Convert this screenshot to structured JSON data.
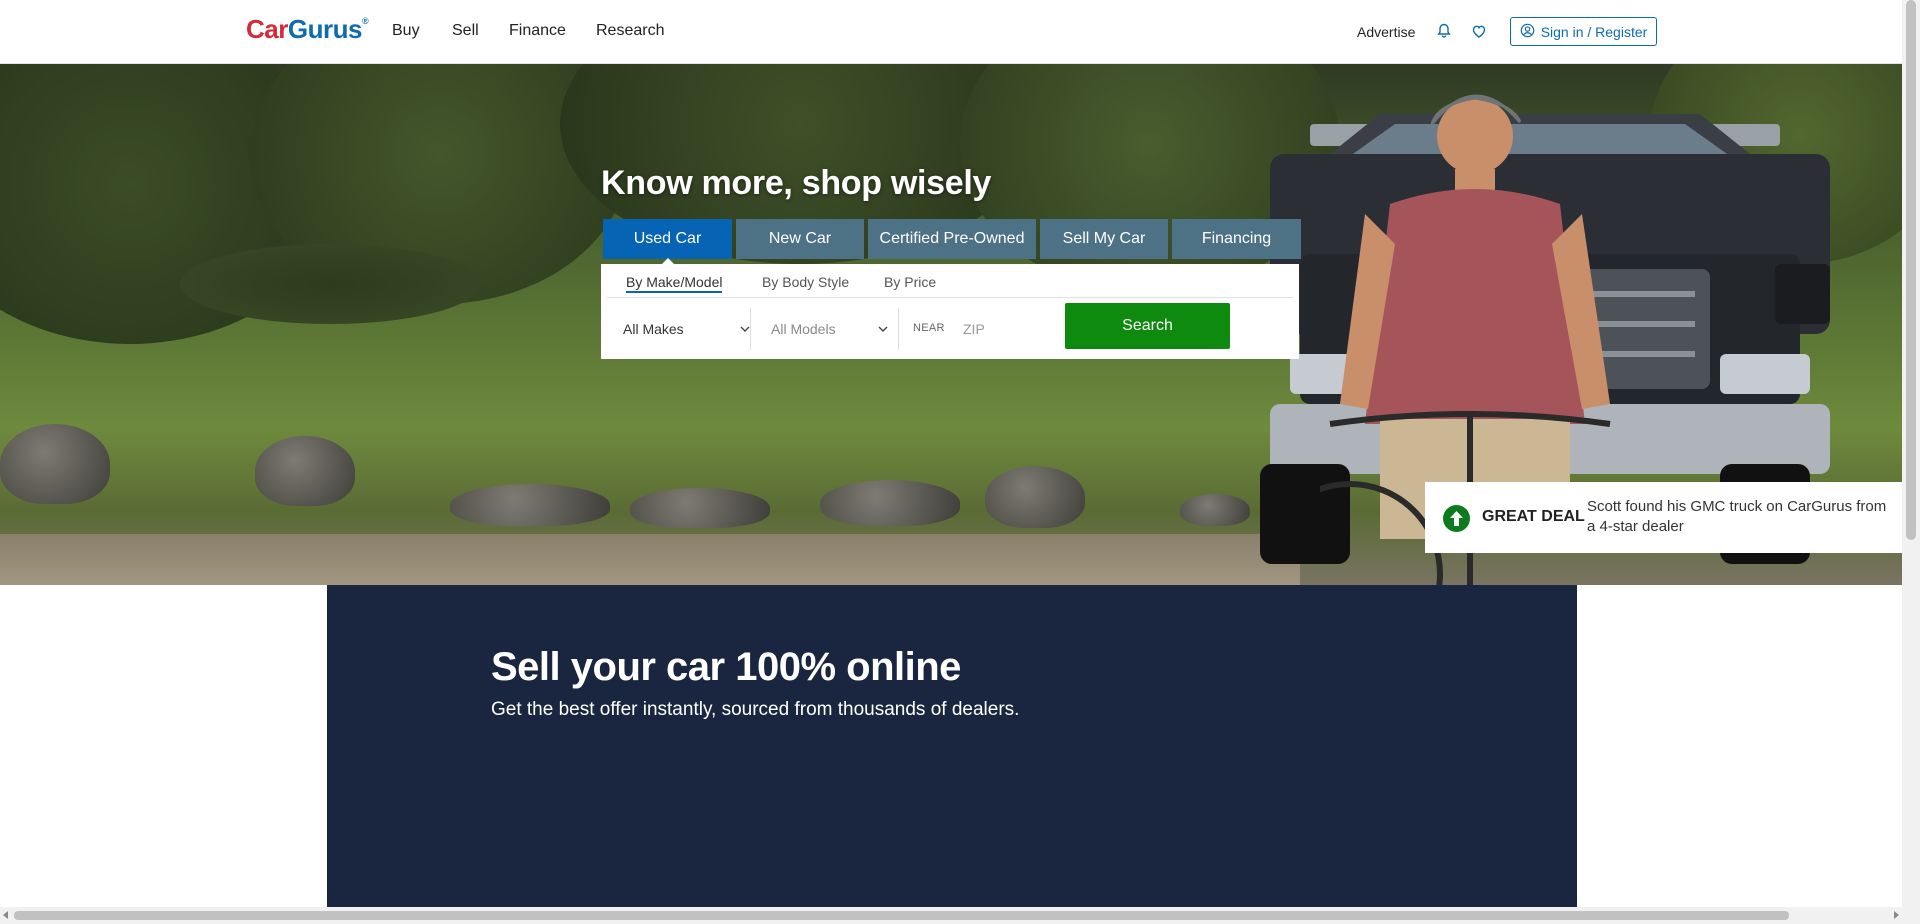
{
  "header": {
    "logo_car": "Car",
    "logo_gurus": "Gurus",
    "logo_reg": "®",
    "nav": [
      "Buy",
      "Sell",
      "Finance",
      "Research"
    ],
    "advertise": "Advertise",
    "signin_label": "Sign in / Register",
    "icons": [
      "bell-icon",
      "heart-icon",
      "user-circle-icon"
    ]
  },
  "hero": {
    "title": "Know more, shop wisely",
    "tabs": [
      "Used Car",
      "New Car",
      "Certified Pre-Owned",
      "Sell My Car",
      "Financing"
    ],
    "active_tab": "Used Car",
    "subtabs": [
      "By Make/Model",
      "By Body Style",
      "By Price"
    ],
    "active_subtab": "By Make/Model",
    "makes_select": "All Makes",
    "models_select": "All Models",
    "near_label": "NEAR",
    "zip_placeholder": "ZIP",
    "search_label": "Search"
  },
  "deal": {
    "label": "GREAT DEAL",
    "text": "Scott found his GMC truck on CarGurus from a 4-star dealer"
  },
  "sell": {
    "title": "Sell your car 100% online",
    "subtitle": "Get the best offer instantly, sourced from thousands of dealers."
  },
  "colors": {
    "brand_red": "#d42a3a",
    "brand_blue": "#0d6bb0",
    "tab_active": "#0763b4",
    "tab_inactive": "#4d7185",
    "search_green": "#0e8a0e",
    "sell_bg": "#1a2540"
  }
}
